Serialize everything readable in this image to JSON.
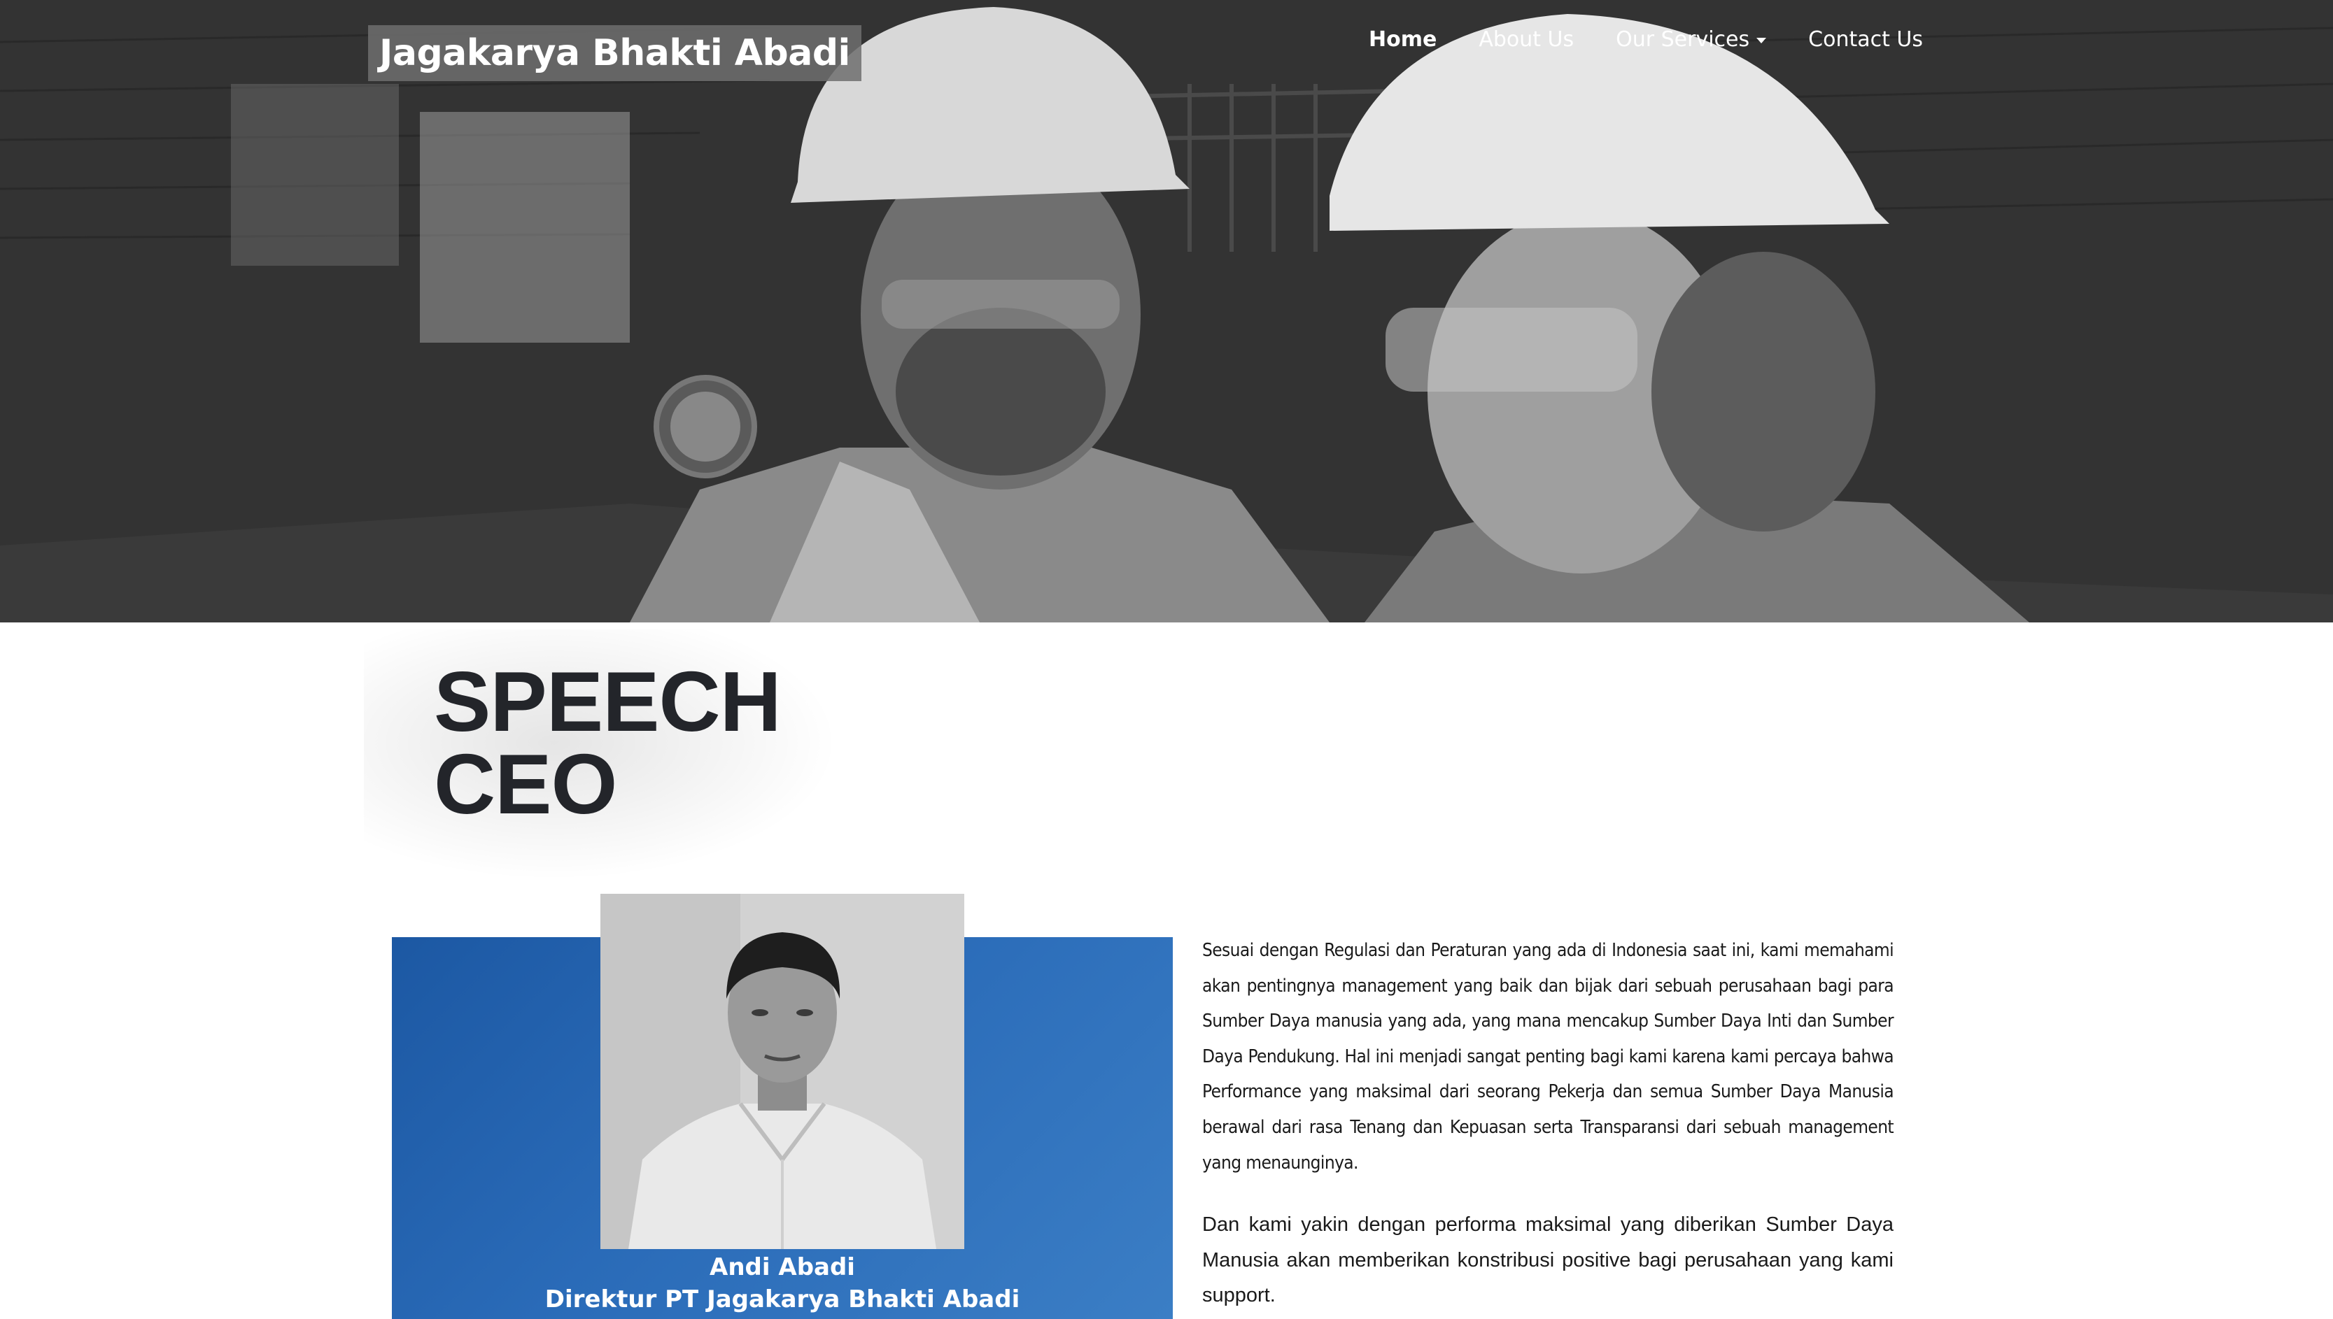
{
  "header": {
    "brand": "Jagakarya Bhakti Abadi",
    "nav": [
      {
        "label": "Home",
        "active": true
      },
      {
        "label": "About Us",
        "active": false
      },
      {
        "label": "Our Services",
        "active": false,
        "has_dropdown": true
      },
      {
        "label": "Contact Us",
        "active": false
      }
    ]
  },
  "hero": {
    "image": "workers-hardhat-photo"
  },
  "section": {
    "heading_line1": "SPEECH",
    "heading_line2": "CEO"
  },
  "ceo": {
    "name": "Andi Abadi",
    "title": "Direktur PT Jagakarya Bhakti Abadi",
    "card_color": "#2a6bb8"
  },
  "speech": {
    "paragraph1": "Sesuai dengan Regulasi dan Peraturan yang ada di Indonesia saat ini, kami memahami akan pentingnya management yang baik dan bijak dari sebuah perusahaan bagi para Sumber Daya manusia yang ada, yang mana mencakup Sumber Daya Inti dan Sumber Daya Pendukung. Hal ini menjadi sangat penting bagi kami karena kami percaya bahwa Performance yang maksimal dari seorang Pekerja dan semua Sumber Daya Manusia berawal dari rasa Tenang dan Kepuasan serta Transparansi dari sebuah management yang menaunginya.",
    "paragraph2": "Dan kami yakin dengan performa maksimal yang diberikan Sumber Daya Manusia akan memberikan konstribusi positive bagi perusahaan yang kami support."
  }
}
